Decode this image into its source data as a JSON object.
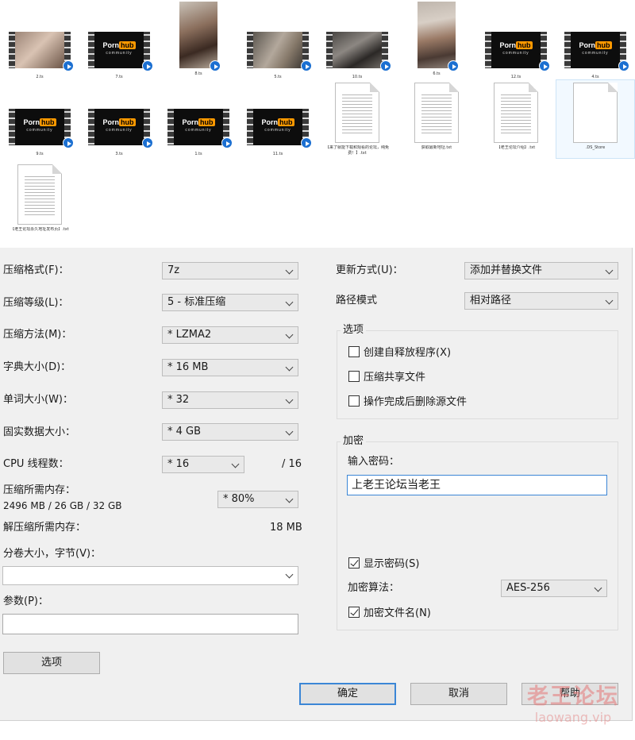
{
  "files": [
    {
      "name": "2.ts",
      "kind": "video",
      "thumb": "photo-a"
    },
    {
      "name": "7.ts",
      "kind": "video",
      "thumb": "ph-logo"
    },
    {
      "name": "8.ts",
      "kind": "portrait",
      "thumb": "photo-p1"
    },
    {
      "name": "5.ts",
      "kind": "video",
      "thumb": "photo-b"
    },
    {
      "name": "10.ts",
      "kind": "video",
      "thumb": "photo-c"
    },
    {
      "name": "6.ts",
      "kind": "portrait",
      "thumb": "photo-p2"
    },
    {
      "name": "12.ts",
      "kind": "video",
      "thumb": "ph-logo"
    },
    {
      "name": "4.ts",
      "kind": "video",
      "thumb": "ph-logo"
    },
    {
      "name": "9.ts",
      "kind": "video",
      "thumb": "ph-logo"
    },
    {
      "name": "3.ts",
      "kind": "video",
      "thumb": "ph-logo"
    },
    {
      "name": "1.ts",
      "kind": "video",
      "thumb": "ph-logo"
    },
    {
      "name": "11.ts",
      "kind": "video",
      "thumb": "ph-logo"
    },
    {
      "name": "【来了就能下载和观看的论坛，纯免费！】.txt",
      "kind": "txt"
    },
    {
      "name": "获取最新地址.txt",
      "kind": "txt"
    },
    {
      "name": "【老王论坛介绍】.txt",
      "kind": "txt"
    },
    {
      "name": ".DS_Store",
      "kind": "blank"
    },
    {
      "name": "【老王论坛永久地址发布页】.txt",
      "kind": "txt"
    }
  ],
  "thumb_logo": {
    "porn": "Porn",
    "hub": "hub",
    "community": "community"
  },
  "dialog": {
    "format_label": "压缩格式(F)：",
    "format_value": "7z",
    "level_label": "压缩等级(L)：",
    "level_value": "5 - 标准压缩",
    "method_label": "压缩方法(M)：",
    "method_value": "* LZMA2",
    "dict_label": "字典大小(D)：",
    "dict_value": "* 16 MB",
    "word_label": "单词大小(W)：",
    "word_value": "* 32",
    "solid_label": "固实数据大小：",
    "solid_value": "* 4 GB",
    "threads_label": "CPU 线程数：",
    "threads_value": "* 16",
    "threads_max": "/ 16",
    "mem_comp_label": "压缩所需内存：",
    "mem_comp_detail": "2496 MB / 26 GB / 32 GB",
    "mem_comp_value": "* 80%",
    "mem_decomp_label": "解压缩所需内存：",
    "mem_decomp_value": "18 MB",
    "volume_label": "分卷大小，字节(V)：",
    "volume_value": "",
    "params_label": "参数(P)：",
    "params_value": "",
    "options_button": "选项",
    "update_label": "更新方式(U)：",
    "update_value": "添加并替换文件",
    "path_label": "路径模式",
    "path_value": "相对路径",
    "options_group": "选项",
    "opt_sfx": "创建自释放程序(X)",
    "opt_sfx_checked": false,
    "opt_shared": "压缩共享文件",
    "opt_shared_checked": false,
    "opt_delete": "操作完成后删除源文件",
    "opt_delete_checked": false,
    "encrypt_group": "加密",
    "password_label": "输入密码：",
    "password_value": "上老王论坛当老王",
    "show_password": "显示密码(S)",
    "show_password_checked": true,
    "enc_method_label": "加密算法：",
    "enc_method_value": "AES-256",
    "enc_names": "加密文件名(N)",
    "enc_names_checked": true,
    "ok_button": "确定",
    "cancel_button": "取消",
    "help_button": "帮助"
  },
  "watermark": {
    "cn": "老王论坛",
    "en": "laowang.vip"
  }
}
